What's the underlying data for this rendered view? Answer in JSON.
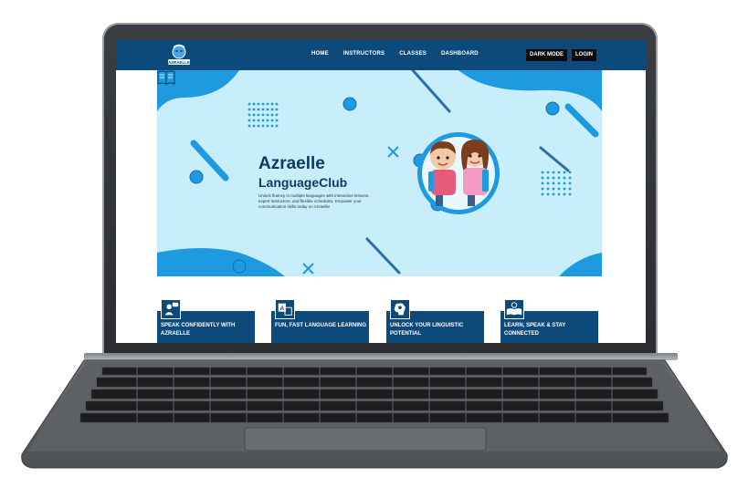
{
  "nav": {
    "links": [
      "HOME",
      "INSTRUCTORS",
      "CLASSES",
      "DASHBOARD"
    ],
    "dark_mode": "DARK MODE",
    "login": "LOGIN",
    "logo_text": "AZRAELLE"
  },
  "hero": {
    "title": "Azraelle",
    "subtitle": "LanguageClub",
    "description": "Unlock fluency in multiple languages with interactive lessons, expert instructors, and flexible schedules. Empower your communication skills today on Azraelle!"
  },
  "cards": [
    {
      "title": "SPEAK CONFIDENTLY WITH AZRAELLE",
      "icon": "speaking-person-icon"
    },
    {
      "title": "FUN, FAST LANGUAGE LEARNING",
      "icon": "translate-icon"
    },
    {
      "title": "UNLOCK YOUR LINGUISTIC POTENTIAL",
      "icon": "brain-icon"
    },
    {
      "title": "LEARN, SPEAK & STAY CONNECTED",
      "icon": "open-book-icon"
    }
  ],
  "colors": {
    "nav": "#0d4a7c",
    "hero_bg": "#c7eefa",
    "accent": "#1e9be0",
    "dark_text": "#0c3c66"
  }
}
